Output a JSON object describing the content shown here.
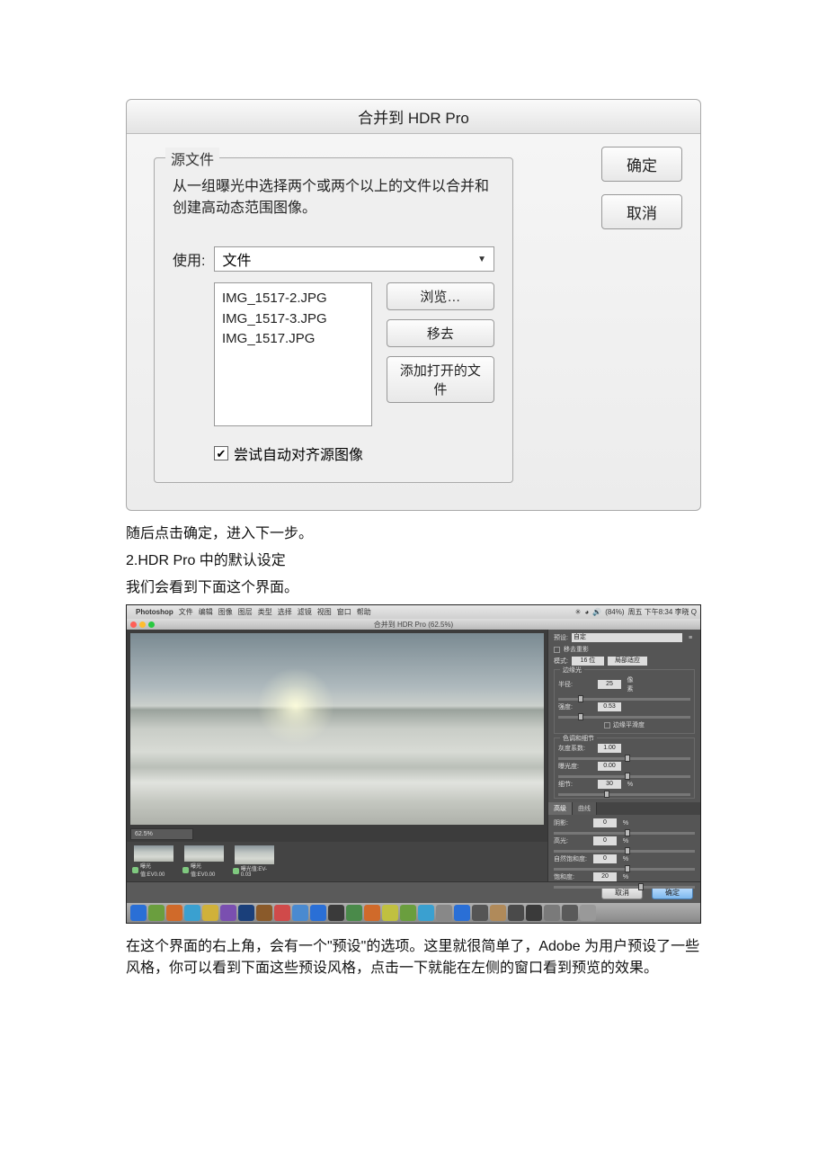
{
  "dialog1": {
    "title": "合并到 HDR Pro",
    "fieldset_legend": "源文件",
    "description": "从一组曝光中选择两个或两个以上的文件以合并和创建高动态范围图像。",
    "use_label": "使用:",
    "select_value": "文件",
    "files": [
      "IMG_1517-2.JPG",
      "IMG_1517-3.JPG",
      "IMG_1517.JPG"
    ],
    "browse": "浏览…",
    "remove": "移去",
    "add_open": "添加打开的文件",
    "align_checkbox": "尝试自动对齐源图像",
    "ok": "确定",
    "cancel": "取消"
  },
  "body_text": {
    "p1": "随后点击确定，进入下一步。",
    "p2": "2.HDR Pro 中的默认设定",
    "p3": "我们会看到下面这个界面。",
    "p4": "在这个界面的右上角，会有一个\"预设\"的选项。这里就很简单了，Adobe 为用户预设了一些风格，你可以看到下面这些预设风格，点击一下就能在左侧的窗口看到预览的效果。"
  },
  "shot2": {
    "menubar": {
      "apple": "",
      "app": "Photoshop",
      "items": [
        "文件",
        "编辑",
        "图像",
        "图层",
        "类型",
        "选择",
        "滤镜",
        "视图",
        "窗口",
        "帮助"
      ],
      "status_right": "周五 下午8:34  李晓  Q",
      "battery": "(84%)"
    },
    "window_title": "合并到 HDR Pro (62.5%)",
    "zoom": "62.5%",
    "thumbs": [
      {
        "label": "曝光值:EV0.00"
      },
      {
        "label": "曝光值:EV0.00"
      },
      {
        "label": "曝光值:EV-0.03"
      }
    ],
    "panel": {
      "preset_label": "预设:",
      "preset_value": "自定",
      "remove_ghost": "移去重影",
      "mode_label": "模式:",
      "mode_value": "16 位",
      "method_value": "局部适应",
      "group_edge": "边缘光",
      "radius_label": "半径:",
      "radius_value": "25",
      "radius_unit": "像素",
      "strength_label": "强度:",
      "strength_value": "0.53",
      "edge_smooth": "边缘平滑度",
      "group_tone": "色调和细节",
      "gamma_label": "灰度系数:",
      "gamma_value": "1.00",
      "exposure_label": "曝光度:",
      "exposure_value": "0.00",
      "detail_label": "细节:",
      "detail_value": "30",
      "tab_advanced": "高级",
      "tab_curve": "曲线",
      "shadow_label": "阴影:",
      "shadow_value": "0",
      "highlight_label": "高光:",
      "highlight_value": "0",
      "vibrance_label": "自然饱和度:",
      "vibrance_value": "0",
      "saturation_label": "饱和度:",
      "saturation_value": "20",
      "percent": "%"
    },
    "bottom": {
      "cancel": "取消",
      "ok": "确定"
    },
    "dock_colors": [
      "#2a6fd6",
      "#6a9e3e",
      "#d06a2a",
      "#3aa0d0",
      "#d0b13a",
      "#7a4fb0",
      "#1a3f7a",
      "#8a5a2a",
      "#d04a4a",
      "#4a8ad0",
      "#2a6fd6",
      "#3a3a3a",
      "#4a8a4a",
      "#d06a2a",
      "#c0c040",
      "#6a9e3e",
      "#3aa0d0",
      "#888",
      "#2a6fd6",
      "#555",
      "#b08a5a",
      "#4a4a4a",
      "#3a3a3a",
      "#7a7a7a",
      "#5a5a5a",
      "#999"
    ]
  }
}
